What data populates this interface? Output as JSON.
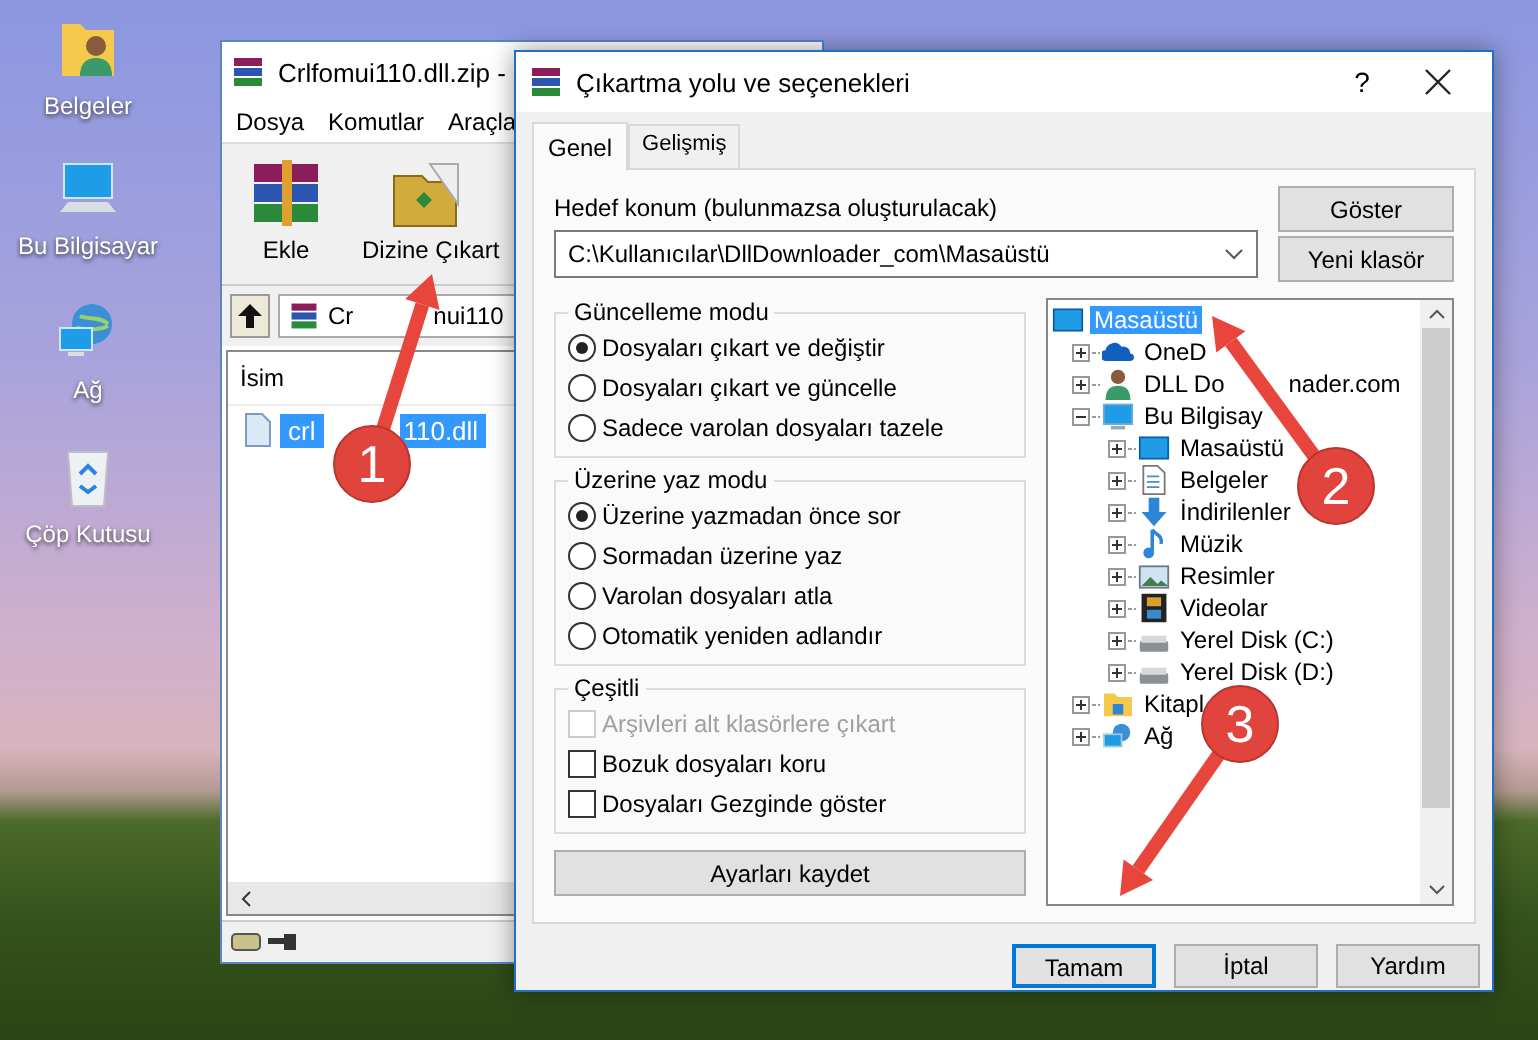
{
  "desktop_icons": [
    {
      "label": "Belgeler",
      "kind": "user-folder"
    },
    {
      "label": "Bu Bilgisayar",
      "kind": "computer"
    },
    {
      "label": "Ağ",
      "kind": "network"
    },
    {
      "label": "Çöp Kutusu",
      "kind": "bin"
    }
  ],
  "archive_window": {
    "title": "Crlfomui110.dll.zip -",
    "menu": [
      "Dosya",
      "Komutlar",
      "Araçla"
    ],
    "toolbar": [
      {
        "label": "Ekle",
        "kind": "add"
      },
      {
        "label": "Dizine Çıkart",
        "kind": "extract"
      }
    ],
    "path_parts": [
      "Cr",
      "nui110"
    ],
    "column": "İsim",
    "files": [
      {
        "name_parts": [
          "crl",
          "110.dll"
        ],
        "selected": true
      }
    ]
  },
  "dialog": {
    "title": "Çıkartma yolu ve seçenekleri",
    "help": "?",
    "tabs": [
      {
        "label": "Genel",
        "selected": true
      },
      {
        "label": "Gelişmiş",
        "selected": false
      }
    ],
    "destination_label": "Hedef konum (bulunmazsa oluşturulacak)",
    "destination": "C:\\Kullanıcılar\\DllDownloader_com\\Masaüstü",
    "side_buttons": [
      "Göster",
      "Yeni klasör"
    ],
    "groups": [
      {
        "title": "Güncelleme modu",
        "options": [
          {
            "kind": "radio",
            "label": "Dosyaları çıkart ve değiştir",
            "checked": true,
            "disabled": false
          },
          {
            "kind": "radio",
            "label": "Dosyaları çıkart ve güncelle",
            "checked": false,
            "disabled": false
          },
          {
            "kind": "radio",
            "label": "Sadece varolan dosyaları tazele",
            "checked": false,
            "disabled": false
          }
        ]
      },
      {
        "title": "Üzerine yaz modu",
        "options": [
          {
            "kind": "radio",
            "label": "Üzerine yazmadan önce sor",
            "checked": true,
            "disabled": false
          },
          {
            "kind": "radio",
            "label": "Sormadan üzerine yaz",
            "checked": false,
            "disabled": false
          },
          {
            "kind": "radio",
            "label": "Varolan dosyaları atla",
            "checked": false,
            "disabled": false
          },
          {
            "kind": "radio",
            "label": "Otomatik yeniden adlandır",
            "checked": false,
            "disabled": false
          }
        ]
      },
      {
        "title": "Çeşitli",
        "options": [
          {
            "kind": "checkbox",
            "label": "Arşivleri alt klasörlere çıkart",
            "checked": false,
            "disabled": true
          },
          {
            "kind": "checkbox",
            "label": "Bozuk dosyaları koru",
            "checked": false,
            "disabled": false
          },
          {
            "kind": "checkbox",
            "label": "Dosyaları Gezginde göster",
            "checked": false,
            "disabled": false
          }
        ]
      }
    ],
    "save_button": "Ayarları kaydet",
    "tree": [
      {
        "label": "Masaüstü",
        "kind": "desktop",
        "selected": true,
        "children": [
          {
            "label": "OneD",
            "kind": "cloud",
            "selected": false,
            "expanded": false
          },
          {
            "label_parts": [
              "DLL Do",
              "nader.com"
            ],
            "kind": "person",
            "selected": false,
            "expanded": false
          },
          {
            "label": "Bu Bilgisay",
            "kind": "computer",
            "selected": false,
            "expanded": true,
            "children": [
              {
                "label": "Masaüstü",
                "kind": "desktop",
                "selected": false,
                "expanded": false
              },
              {
                "label": "Belgeler",
                "kind": "document",
                "selected": false,
                "expanded": false
              },
              {
                "label": "İndirilenler",
                "kind": "download",
                "selected": false,
                "expanded": false
              },
              {
                "label": "Müzik",
                "kind": "music",
                "selected": false,
                "expanded": false
              },
              {
                "label": "Resimler",
                "kind": "picture",
                "selected": false,
                "expanded": false
              },
              {
                "label": "Videolar",
                "kind": "video",
                "selected": false,
                "expanded": false
              },
              {
                "label": "Yerel Disk (C:)",
                "kind": "drive",
                "selected": false,
                "expanded": false
              },
              {
                "label": "Yerel Disk (D:)",
                "kind": "drive",
                "selected": false,
                "expanded": false
              }
            ]
          },
          {
            "label": "Kitapl",
            "kind": "library",
            "selected": false,
            "expanded": false
          },
          {
            "label": "Ağ",
            "kind": "network",
            "selected": false,
            "expanded": false
          }
        ]
      }
    ],
    "buttons": [
      {
        "label": "Tamam",
        "focused": true
      },
      {
        "label": "İptal",
        "focused": false
      },
      {
        "label": "Yardım",
        "focused": false
      }
    ]
  },
  "annotations": [
    {
      "number": "1"
    },
    {
      "number": "2"
    },
    {
      "number": "3"
    }
  ]
}
